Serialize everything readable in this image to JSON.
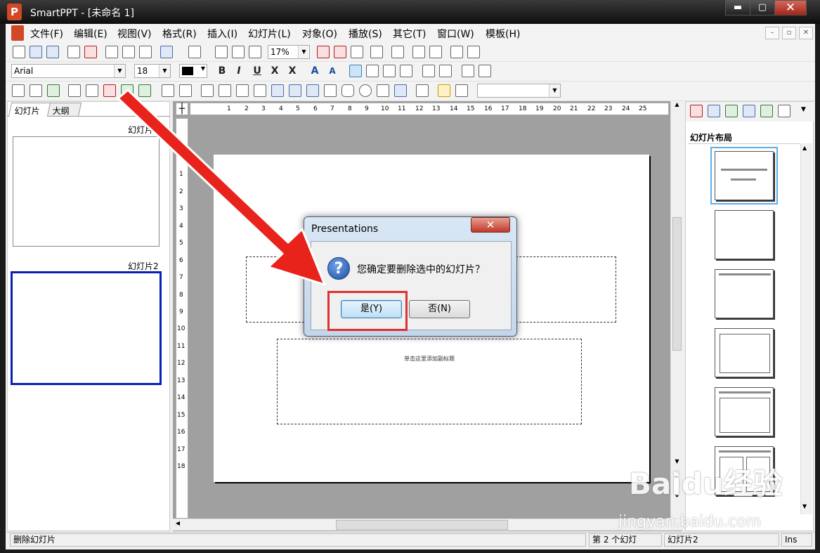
{
  "window": {
    "app_icon": "P",
    "title": "SmartPPT   - [未命名 1]",
    "minimize": "▬",
    "maximize": "▢",
    "close": "✕"
  },
  "menu": [
    "文件(F)",
    "编辑(E)",
    "视图(V)",
    "格式(R)",
    "插入(I)",
    "幻灯片(L)",
    "对象(O)",
    "播放(S)",
    "其它(T)",
    "窗口(W)",
    "模板(H)"
  ],
  "mdi_buttons": [
    "–",
    "▫",
    "✕"
  ],
  "toolbar1": {
    "zoom": "17%"
  },
  "toolbar2": {
    "font": "Arial",
    "size": "18",
    "bold": "B",
    "italic": "I",
    "underline": "U",
    "strike": "X",
    "shadow": "X",
    "grow": "A",
    "shrink": "A"
  },
  "toolbar3": {
    "style_combo": ""
  },
  "left_panel": {
    "tabs": [
      "幻灯片",
      "大纲"
    ],
    "slides": [
      {
        "label": "幻灯片"
      },
      {
        "label": "幻灯片2"
      }
    ]
  },
  "ruler": {
    "h": [
      "1",
      "2",
      "3",
      "4",
      "5",
      "6",
      "7",
      "8",
      "9",
      "10",
      "11",
      "12",
      "13",
      "14",
      "15",
      "16",
      "17",
      "18",
      "19",
      "20",
      "21",
      "22",
      "23",
      "24",
      "25"
    ],
    "v": [
      "1",
      "2",
      "3",
      "4",
      "5",
      "6",
      "7",
      "8",
      "9",
      "10",
      "11",
      "12",
      "13",
      "14",
      "15",
      "16",
      "17",
      "18"
    ]
  },
  "slide": {
    "subtitle_placeholder": "单击这里添加副标题"
  },
  "right_panel": {
    "title": "幻灯片布局"
  },
  "status": {
    "left": "删除幻灯片",
    "slide_index": "第 2 个幻灯",
    "slide_name": "幻灯片2",
    "mode": "Ins"
  },
  "dialog": {
    "title": "Presentations",
    "close": "✕",
    "icon": "?",
    "message": "您确定要删除选中的幻灯片？",
    "yes": "是(Y)",
    "no": "否(N)"
  },
  "watermark": {
    "brand": "Baidu经验",
    "url": "jingyan.baidu.com"
  }
}
